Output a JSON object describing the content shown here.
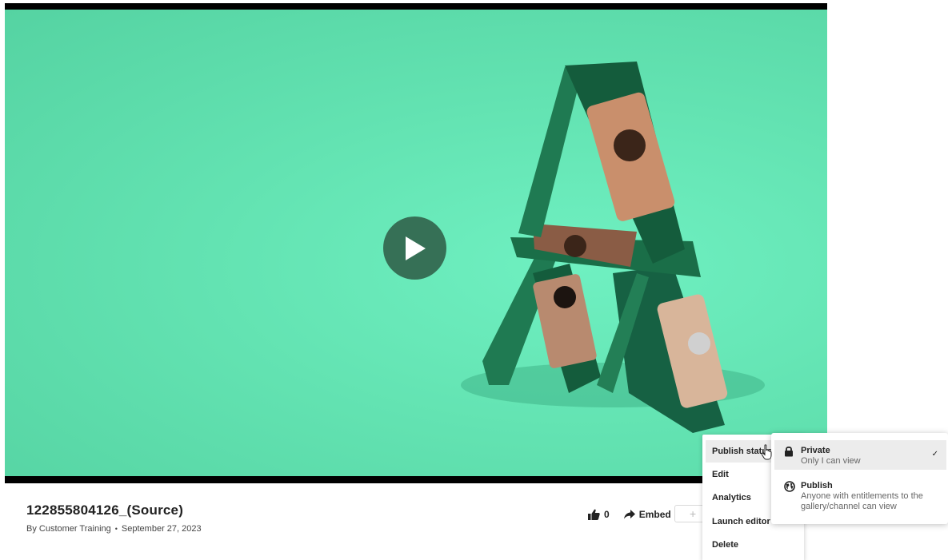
{
  "video": {
    "title": "122855804126_(Source)",
    "author": "By Customer Training",
    "separator": "•",
    "date": "September 27, 2023"
  },
  "actions": {
    "likes": "0",
    "embed_label": "Embed",
    "more_glyph": "+"
  },
  "menu": {
    "items": [
      "Publish status",
      "Edit",
      "Analytics",
      "Launch editor",
      "Delete"
    ]
  },
  "publish_status": {
    "options": [
      {
        "label": "Private",
        "description": "Only I can view",
        "icon": "lock-icon",
        "selected_mark": "✓"
      },
      {
        "label": "Publish",
        "description": "Anyone with entitlements to the gallery/channel can view",
        "icon": "globe-icon"
      }
    ]
  },
  "colors": {
    "video_bg": "#63e3b2",
    "play_button": "#2f5e48",
    "phone_body": "#1d6b48"
  }
}
